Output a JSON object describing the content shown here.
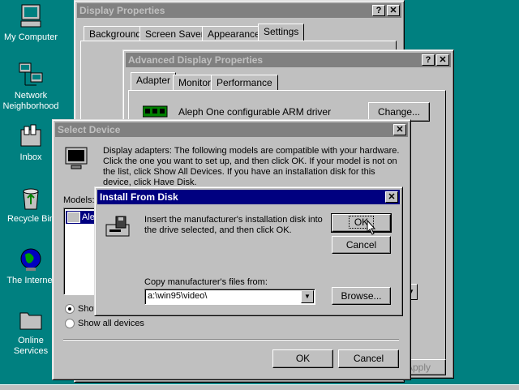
{
  "desktop": {
    "icons": [
      {
        "label": "My Computer"
      },
      {
        "label": "Network Neighborhood"
      },
      {
        "label": "Inbox"
      },
      {
        "label": "Recycle Bin"
      },
      {
        "label": "The Internet"
      },
      {
        "label": "Online Services"
      }
    ]
  },
  "display_properties": {
    "title": "Display Properties",
    "tabs": [
      "Background",
      "Screen Saver",
      "Appearance",
      "Settings"
    ],
    "apply_label": "Apply"
  },
  "advanced": {
    "title": "Advanced Display Properties",
    "tabs": [
      "Adapter",
      "Monitor",
      "Performance"
    ],
    "driver_name": "Aleph One configurable ARM driver",
    "change_label": "Change..."
  },
  "select_device": {
    "title": "Select Device",
    "description": [
      "Display adapters: The following models are compatible with your hardware.",
      "Click the one you want to set up, and then click OK. If your model is not on",
      "the list, click Show All Devices. If you have an installation disk for this",
      "device, click Have Disk."
    ],
    "models_label": "Models:",
    "model_item": "Aleph",
    "show_compatible": "Show",
    "show_all": "Show all devices",
    "ok_label": "OK",
    "cancel_label": "Cancel"
  },
  "install_disk": {
    "title": "Install From Disk",
    "message_line1": "Insert the manufacturer's installation disk into",
    "message_line2": "the drive selected, and then click OK.",
    "ok_label": "OK",
    "cancel_label": "Cancel",
    "copy_label": "Copy manufacturer's files from:",
    "path_value": "a:\\win95\\video\\",
    "browse_label": "Browse..."
  },
  "colors": {
    "desktop": "#008080",
    "active_title": "#000080",
    "inactive_title": "#808080",
    "face": "#c0c0c0"
  }
}
